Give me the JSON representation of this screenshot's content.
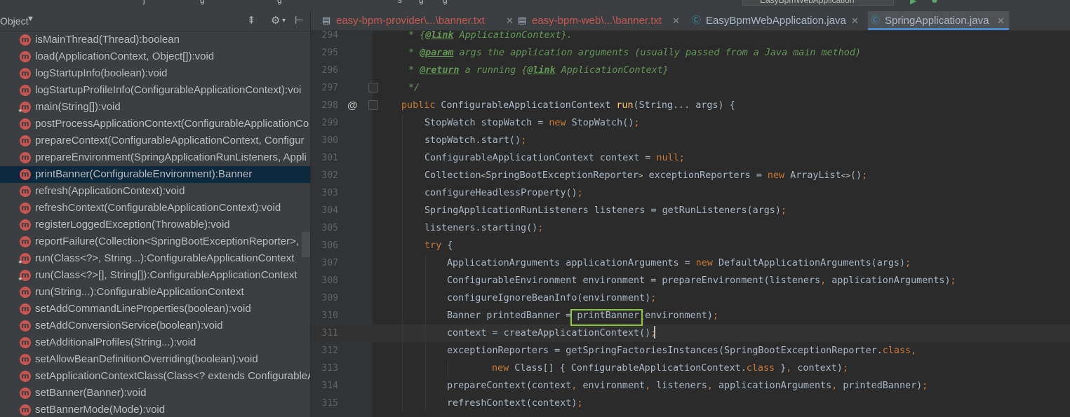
{
  "top_strip": {
    "fragments": [
      "j",
      "g",
      "g",
      "s",
      "g",
      "g"
    ],
    "run_config": "EasyBpmWebApplication"
  },
  "structure": {
    "title": "Object",
    "items": [
      {
        "label": "isMainThread(Thread):boolean",
        "icon": "method-icon",
        "static": false
      },
      {
        "label": "load(ApplicationContext, Object[]):void",
        "icon": "method-icon",
        "static": false
      },
      {
        "label": "logStartupInfo(boolean):void",
        "icon": "method-icon",
        "static": false
      },
      {
        "label": "logStartupProfileInfo(ConfigurableApplicationContext):voi",
        "icon": "method-icon",
        "static": false
      },
      {
        "label": "main(String[]):void",
        "icon": "method-icon",
        "static": true
      },
      {
        "label": "postProcessApplicationContext(ConfigurableApplicationCo",
        "icon": "method-icon",
        "static": false
      },
      {
        "label": "prepareContext(ConfigurableApplicationContext, Configur",
        "icon": "method-icon",
        "static": false
      },
      {
        "label": "prepareEnvironment(SpringApplicationRunListeners, Appli",
        "icon": "method-icon",
        "static": false
      },
      {
        "label": "printBanner(ConfigurableEnvironment):Banner",
        "icon": "method-icon",
        "static": false,
        "selected": true
      },
      {
        "label": "refresh(ApplicationContext):void",
        "icon": "method-icon",
        "static": false
      },
      {
        "label": "refreshContext(ConfigurableApplicationContext):void",
        "icon": "method-icon",
        "static": false
      },
      {
        "label": "registerLoggedException(Throwable):void",
        "icon": "method-icon",
        "static": false
      },
      {
        "label": "reportFailure(Collection<SpringBootExceptionReporter>, T",
        "icon": "method-icon",
        "static": false
      },
      {
        "label": "run(Class<?>, String...):ConfigurableApplicationContext",
        "icon": "method-icon",
        "static": true
      },
      {
        "label": "run(Class<?>[], String[]):ConfigurableApplicationContext",
        "icon": "method-icon",
        "static": true
      },
      {
        "label": "run(String...):ConfigurableApplicationContext",
        "icon": "method-icon",
        "static": false
      },
      {
        "label": "setAddCommandLineProperties(boolean):void",
        "icon": "method-icon",
        "static": false
      },
      {
        "label": "setAddConversionService(boolean):void",
        "icon": "method-icon",
        "static": false
      },
      {
        "label": "setAdditionalProfiles(String...):void",
        "icon": "method-icon",
        "static": false
      },
      {
        "label": "setAllowBeanDefinitionOverriding(boolean):void",
        "icon": "method-icon",
        "static": false
      },
      {
        "label": "setApplicationContextClass(Class<? extends ConfigurableA",
        "icon": "method-icon",
        "static": false
      },
      {
        "label": "setBanner(Banner):void",
        "icon": "method-icon",
        "static": false
      },
      {
        "label": "setBannerMode(Mode):void",
        "icon": "method-icon",
        "static": false
      }
    ]
  },
  "tabs": [
    {
      "label": "easy-bpm-provider\\...\\banner.txt",
      "icon": "text-file-icon",
      "color": "#c75450"
    },
    {
      "label": "easy-bpm-web\\...\\banner.txt",
      "icon": "text-file-icon",
      "color": "#c75450"
    },
    {
      "label": "EasyBpmWebApplication.java",
      "icon": "java-class-icon",
      "color": "#a9b7c6"
    },
    {
      "label": "SpringApplication.java",
      "icon": "java-class-icon",
      "color": "#a9b7c6",
      "active": true
    }
  ],
  "editor": {
    "lines": [
      {
        "n": "294",
        "c": "* {@link ApplicationContext}."
      },
      {
        "n": "295",
        "c": "* @param args the application arguments (usually passed from a Java main method)"
      },
      {
        "n": "296",
        "c": "* @return a running {@link ApplicationContext}"
      },
      {
        "n": "297",
        "c": "*/"
      },
      {
        "n": "298",
        "c": "public ConfigurableApplicationContext run(String... args) {"
      },
      {
        "n": "299",
        "c": "StopWatch stopWatch = new StopWatch();"
      },
      {
        "n": "300",
        "c": "stopWatch.start();"
      },
      {
        "n": "301",
        "c": "ConfigurableApplicationContext context = null;"
      },
      {
        "n": "302",
        "c": "Collection<SpringBootExceptionReporter> exceptionReporters = new ArrayList<>();"
      },
      {
        "n": "303",
        "c": "configureHeadlessProperty();"
      },
      {
        "n": "304",
        "c": "SpringApplicationRunListeners listeners = getRunListeners(args);"
      },
      {
        "n": "305",
        "c": "listeners.starting();"
      },
      {
        "n": "306",
        "c": "try {"
      },
      {
        "n": "307",
        "c": "ApplicationArguments applicationArguments = new DefaultApplicationArguments(args);"
      },
      {
        "n": "308",
        "c": "ConfigurableEnvironment environment = prepareEnvironment(listeners, applicationArguments);"
      },
      {
        "n": "309",
        "c": "configureIgnoreBeanInfo(environment);"
      },
      {
        "n": "310",
        "c": "Banner printedBanner = printBanner(environment);"
      },
      {
        "n": "311",
        "c": "context = createApplicationContext();"
      },
      {
        "n": "312",
        "c": "exceptionReporters = getSpringFactoriesInstances(SpringBootExceptionReporter.class,"
      },
      {
        "n": "313",
        "c": "new Class[] { ConfigurableApplicationContext.class }, context);"
      },
      {
        "n": "314",
        "c": "prepareContext(context, environment, listeners, applicationArguments, printedBanner);"
      },
      {
        "n": "315",
        "c": "refreshContext(context);"
      }
    ]
  },
  "colors": {
    "panel_bg": "#3c3f41",
    "editor_bg": "#2b2b2b",
    "selection": "#0d293e",
    "keyword": "#cc7832",
    "javadoc": "#629755",
    "highlight_box": "#8ec63f"
  }
}
